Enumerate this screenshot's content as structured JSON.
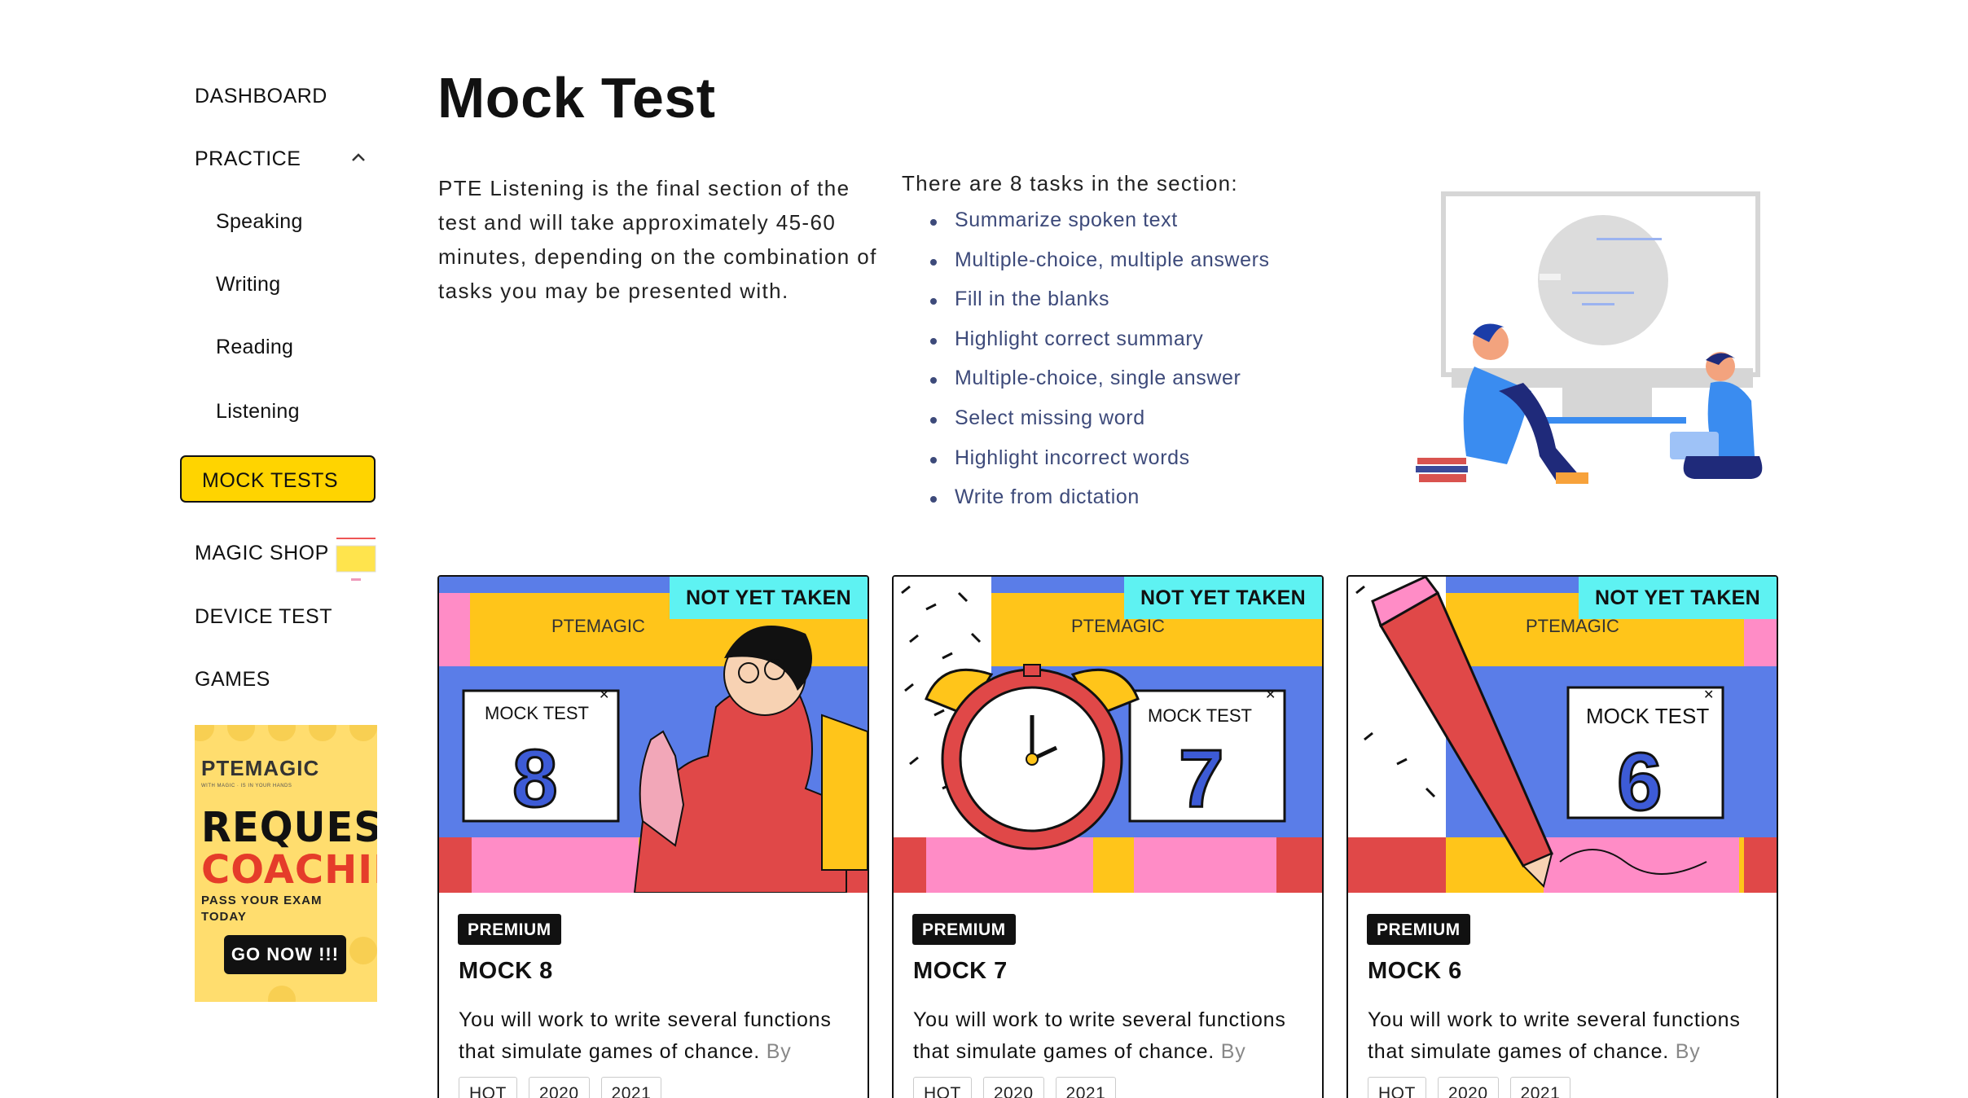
{
  "sidebar": {
    "items": [
      {
        "label": "DASHBOARD"
      },
      {
        "label": "PRACTICE"
      },
      {
        "label": "Speaking"
      },
      {
        "label": "Writing"
      },
      {
        "label": "Reading"
      },
      {
        "label": "Listening"
      },
      {
        "label": "MOCK TESTS"
      },
      {
        "label": "MAGIC SHOP"
      },
      {
        "label": "DEVICE TEST"
      },
      {
        "label": "GAMES"
      }
    ],
    "promo": {
      "logo": "PTEMAGIC",
      "tagline": "WITH MAGIC · IS IN YOUR HANDS",
      "line1": "REQUEST",
      "line2": "COACHING",
      "sub": "PASS YOUR EXAM TODAY",
      "cta": "GO NOW !!!"
    }
  },
  "main": {
    "title": "Mock Test",
    "intro": "PTE Listening is the final section of the test and will take approximately 45-60 minutes, depending on the combination of tasks you may be presented with.",
    "tasks_heading": "There are 8 tasks in the section:",
    "tasks": [
      "Summarize spoken text",
      "Multiple-choice, multiple answers",
      "Fill in the blanks",
      "Highlight correct summary",
      "Multiple-choice, single answer",
      "Select missing word",
      "Highlight incorrect words",
      "Write from dictation"
    ]
  },
  "cards": [
    {
      "status": "NOT YET TAKEN",
      "art_logo": "PTEMAGIC",
      "art_label": "MOCK TEST",
      "art_number": "8",
      "badge": "PREMIUM",
      "name": "MOCK 8",
      "desc": "You will work to write several functions that simulate games of chance.",
      "desc_fade": "By",
      "tags": [
        "HOT",
        "2020",
        "2021"
      ]
    },
    {
      "status": "NOT YET TAKEN",
      "art_logo": "PTEMAGIC",
      "art_label": "MOCK TEST",
      "art_number": "7",
      "badge": "PREMIUM",
      "name": "MOCK 7",
      "desc": "You will work to write several functions that simulate games of chance.",
      "desc_fade": "By",
      "tags": [
        "HOT",
        "2020",
        "2021"
      ]
    },
    {
      "status": "NOT YET TAKEN",
      "art_logo": "PTEMAGIC",
      "art_label": "MOCK TEST",
      "art_number": "6",
      "badge": "PREMIUM",
      "name": "MOCK 6",
      "desc": "You will work to write several functions that simulate games of chance.",
      "desc_fade": "By",
      "tags": [
        "HOT",
        "2020",
        "2021"
      ]
    }
  ],
  "colors": {
    "accent_yellow": "#ffd400",
    "status_cyan": "#5ef2f2",
    "art_blue": "#5a7de8",
    "art_yellow": "#ffc51a",
    "art_pink": "#ff8cc6",
    "art_red": "#e04848"
  },
  "icons": {
    "practice_toggle": "chevron-up-icon",
    "art_close": "close-icon"
  }
}
